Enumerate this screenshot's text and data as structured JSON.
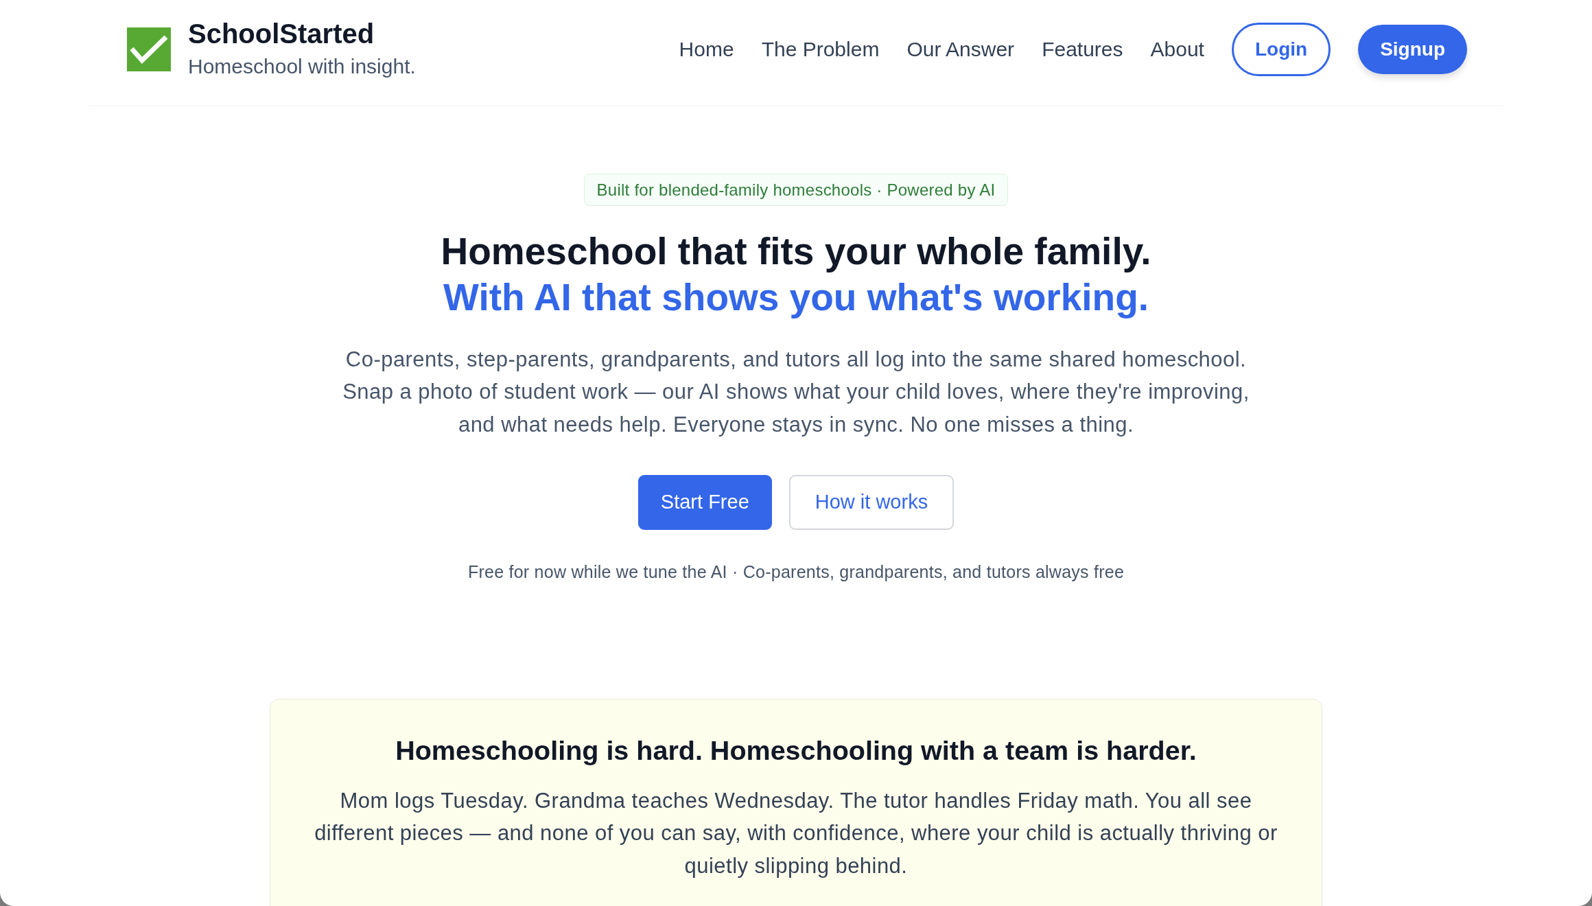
{
  "header": {
    "brand": {
      "name": "SchoolStarted",
      "tagline": "Homeschool with insight."
    },
    "nav": [
      {
        "label": "Home",
        "kind": "link"
      },
      {
        "label": "The Problem",
        "kind": "link"
      },
      {
        "label": "Our Answer",
        "kind": "link"
      },
      {
        "label": "Features",
        "kind": "link"
      },
      {
        "label": "About",
        "kind": "link"
      },
      {
        "label": "Login",
        "kind": "outline"
      },
      {
        "label": "Signup",
        "kind": "primary"
      }
    ]
  },
  "hero": {
    "badge": "Built for blended-family homeschools · Powered by AI",
    "headline": "Homeschool that fits your whole family.",
    "headline_accent": "With AI that shows you what's working.",
    "intro": "Co-parents, step-parents, grandparents, and tutors all log into the same shared homeschool. Snap a photo of student work — our AI shows what your child loves, where they're improving, and what needs help. Everyone stays in sync. No one misses a thing.",
    "buttons": [
      {
        "label": "Start Free",
        "kind": "primary"
      },
      {
        "label": "How it works",
        "kind": "secondary"
      }
    ],
    "note": "Free for now while we tune the AI · Co-parents, grandparents, and tutors always free"
  },
  "problem": {
    "title": "Homeschooling is hard. Homeschooling with a team is harder.",
    "body": "Mom logs Tuesday. Grandma teaches Wednesday. The tutor handles Friday math. You all see different pieces — and none of you can say, with confidence, where your child is actually thriving or quietly slipping behind."
  }
}
